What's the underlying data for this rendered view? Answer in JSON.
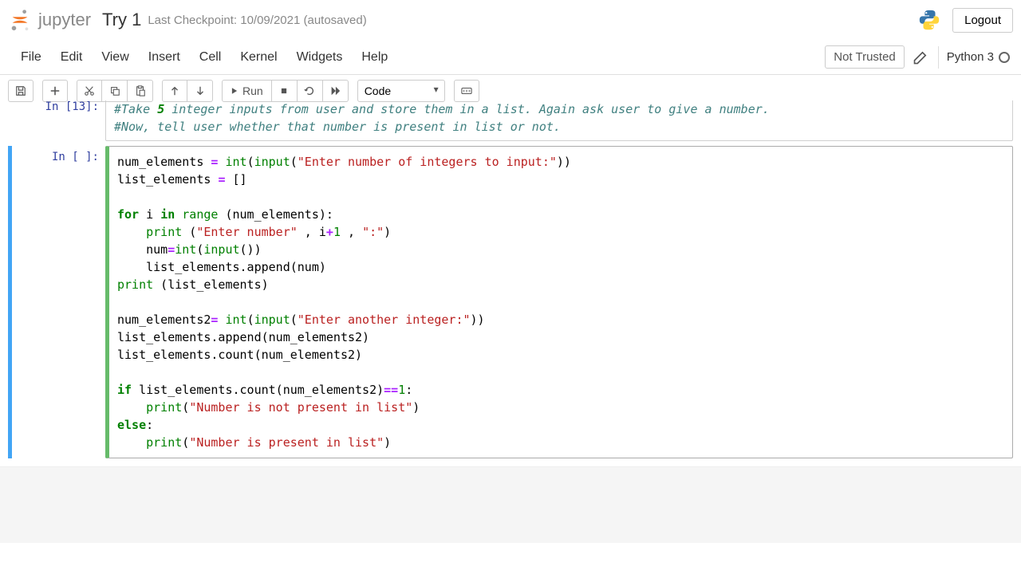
{
  "header": {
    "brand": "jupyter",
    "title": "Try 1",
    "checkpoint": "Last Checkpoint: 10/09/2021  (autosaved)",
    "logout": "Logout"
  },
  "menubar": {
    "items": [
      "File",
      "Edit",
      "View",
      "Insert",
      "Cell",
      "Kernel",
      "Widgets",
      "Help"
    ],
    "not_trusted": "Not Trusted",
    "kernel_name": "Python 3"
  },
  "toolbar": {
    "run_label": "Run",
    "celltype": "Code"
  },
  "cells": {
    "top": {
      "prompt": "In [13]:",
      "line1_a": "#Take ",
      "line1_b": "5",
      "line1_c": " integer inputs from user and store them in a list. Again ask user to give a number.",
      "line2": "#Now, tell user whether that number is present in list or not."
    },
    "active": {
      "prompt": "In [ ]:",
      "l1": {
        "v1": "num_elements ",
        "op": "=",
        "sp": " ",
        "b1": "int",
        "p1": "(",
        "b2": "input",
        "p2": "(",
        "str": "\"Enter number of integers to input:\"",
        "p3": "))"
      },
      "l2": {
        "v1": "list_elements ",
        "op": "=",
        "sp": " ",
        "b": "[]"
      },
      "l3": {
        "kw1": "for",
        "sp1": " i ",
        "kw2": "in",
        "sp2": " ",
        "b": "range",
        "rest": " (num_elements):"
      },
      "l4": {
        "pad": "    ",
        "b": "print",
        "p1": " (",
        "str": "\"Enter number\"",
        "mid": " , i",
        "op": "+",
        "num": "1",
        "rest": " , ",
        "str2": "\":\"",
        "p2": ")"
      },
      "l5": {
        "pad": "    ",
        "v": "num",
        "op": "=",
        "b1": "int",
        "p1": "(",
        "b2": "input",
        "p2": "())"
      },
      "l6": {
        "pad": "    ",
        "rest": "list_elements.append(num)"
      },
      "l7": {
        "b": "print",
        "rest": " (list_elements)"
      },
      "l8": {
        "v": "num_elements2",
        "op": "=",
        "sp": " ",
        "b1": "int",
        "p1": "(",
        "b2": "input",
        "p2": "(",
        "str": "\"Enter another integer:\"",
        "p3": "))"
      },
      "l9": {
        "rest": "list_elements.append(num_elements2)"
      },
      "l10": {
        "rest": "list_elements.count(num_elements2)"
      },
      "l11": {
        "kw": "if",
        "sp": " list_elements.count(num_elements2)",
        "op": "==",
        "num": "1",
        "rest": ":"
      },
      "l12": {
        "pad": "    ",
        "b": "print",
        "p1": "(",
        "str": "\"Number is not present in list\"",
        "p2": ")"
      },
      "l13": {
        "kw": "else",
        "rest": ":"
      },
      "l14": {
        "pad": "    ",
        "b": "print",
        "p1": "(",
        "str": "\"Number is present in list\"",
        "p2": ")"
      }
    }
  }
}
